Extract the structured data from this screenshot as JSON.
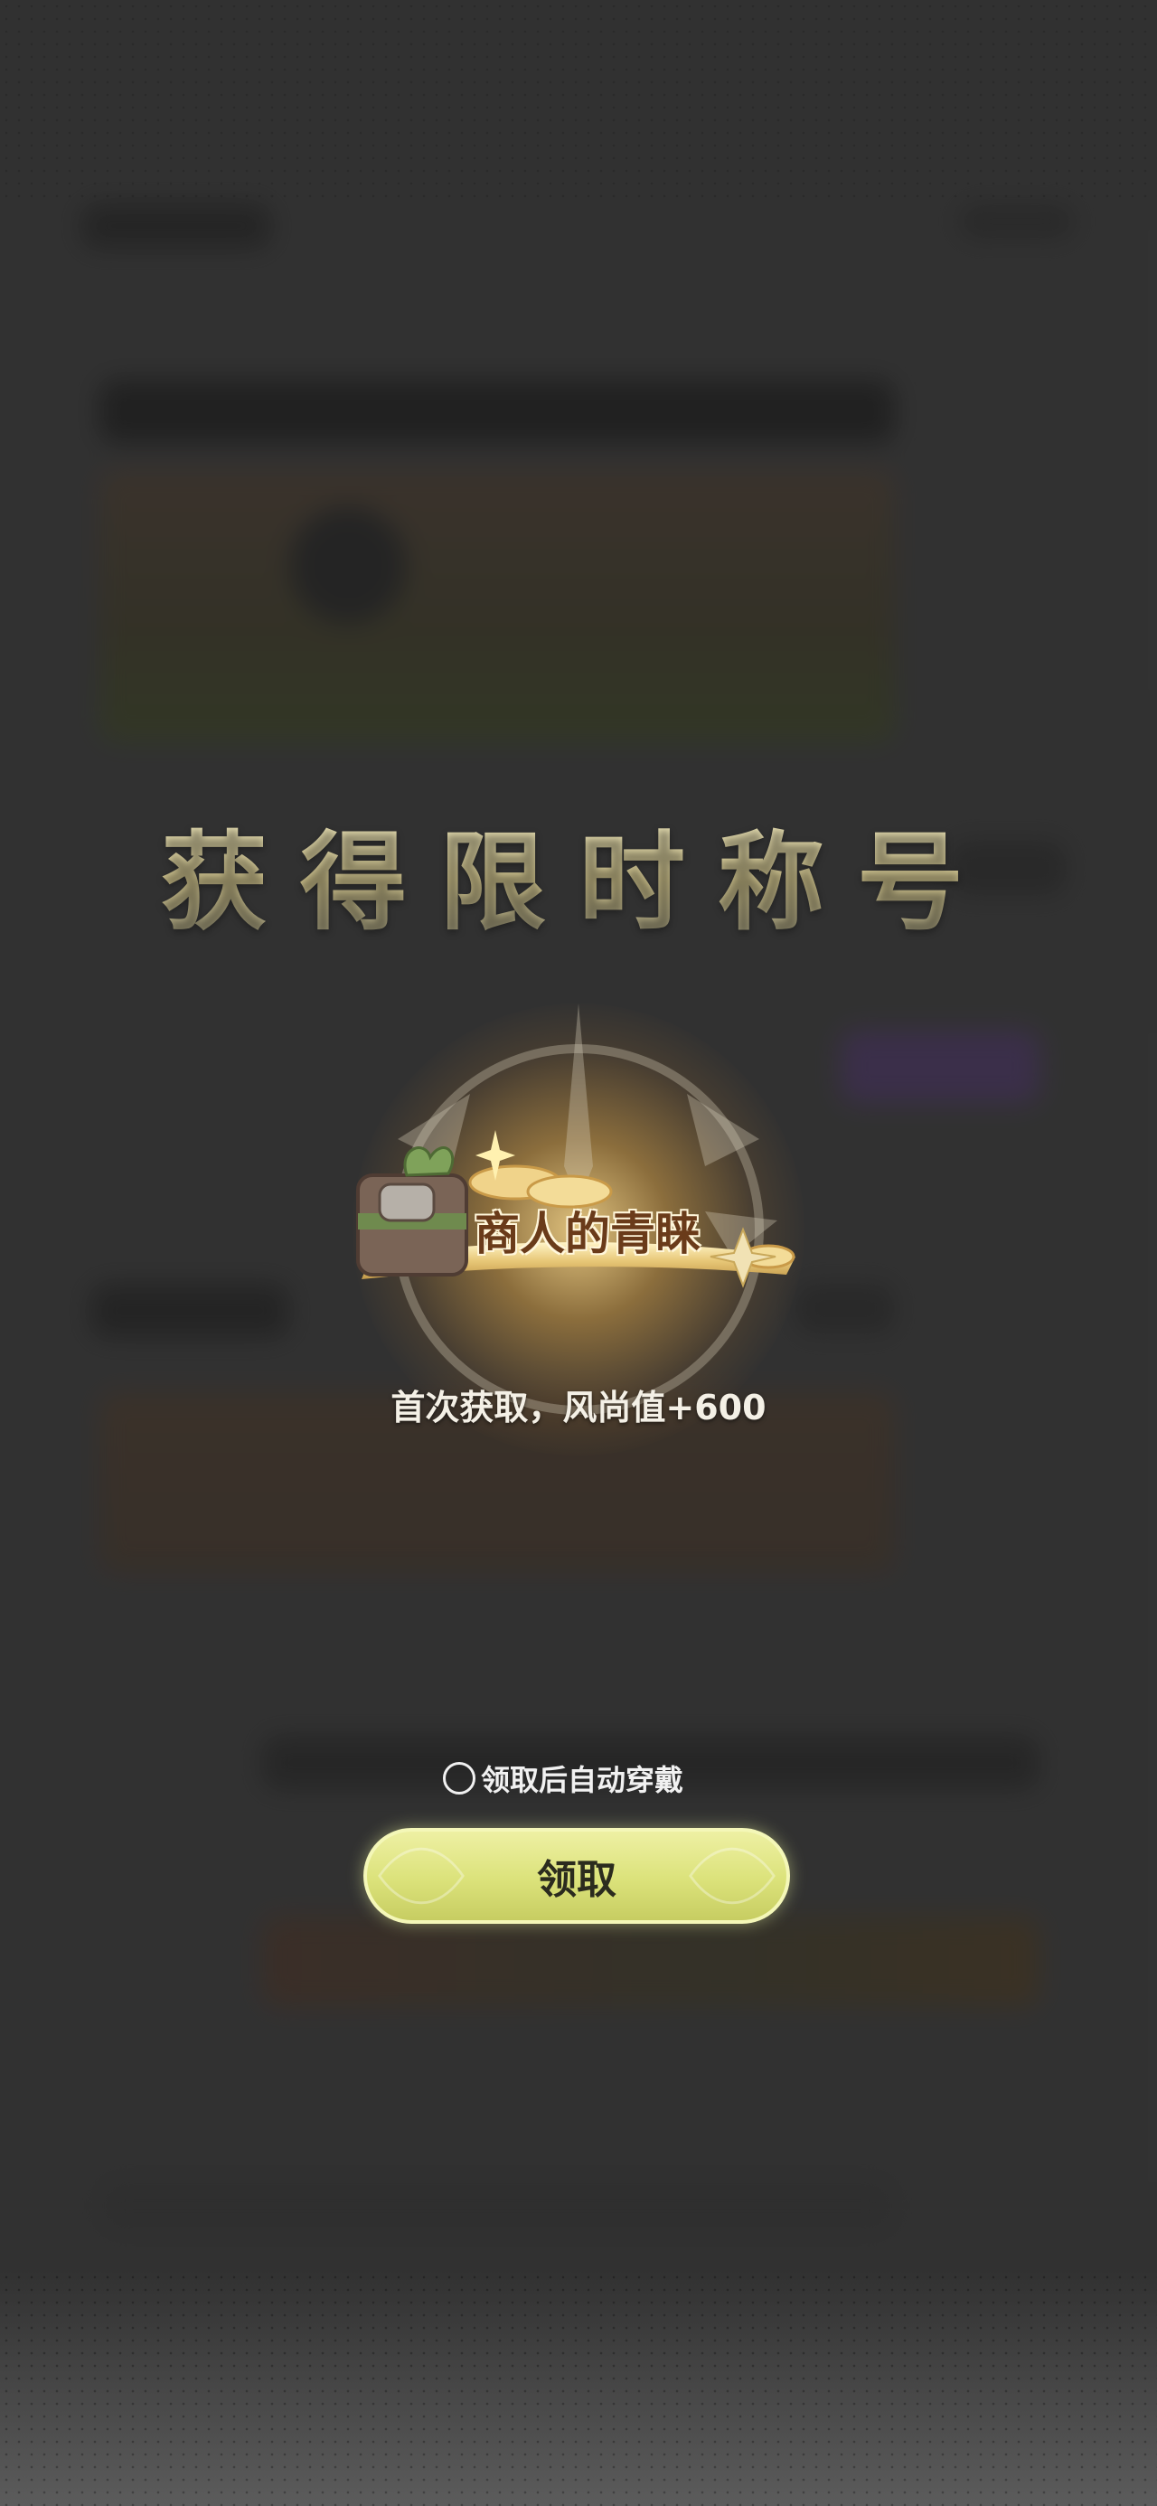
{
  "modal": {
    "title": "获得限时称号",
    "badge_name": "商人的青睐",
    "reward_text": "首次获取，风尚值+600",
    "auto_wear_label": "领取后自动穿戴",
    "auto_wear_checked": false,
    "claim_label": "领取"
  },
  "colors": {
    "title": "#e6dfb4",
    "button": "#dbe27a",
    "badge_text": "#6a3b1a",
    "backdrop": "#3a3a3a"
  },
  "icons": [
    "emblem-icon",
    "treasure-chest-icon",
    "sparkle-icon",
    "gold-coins-icon",
    "radio-icon"
  ]
}
